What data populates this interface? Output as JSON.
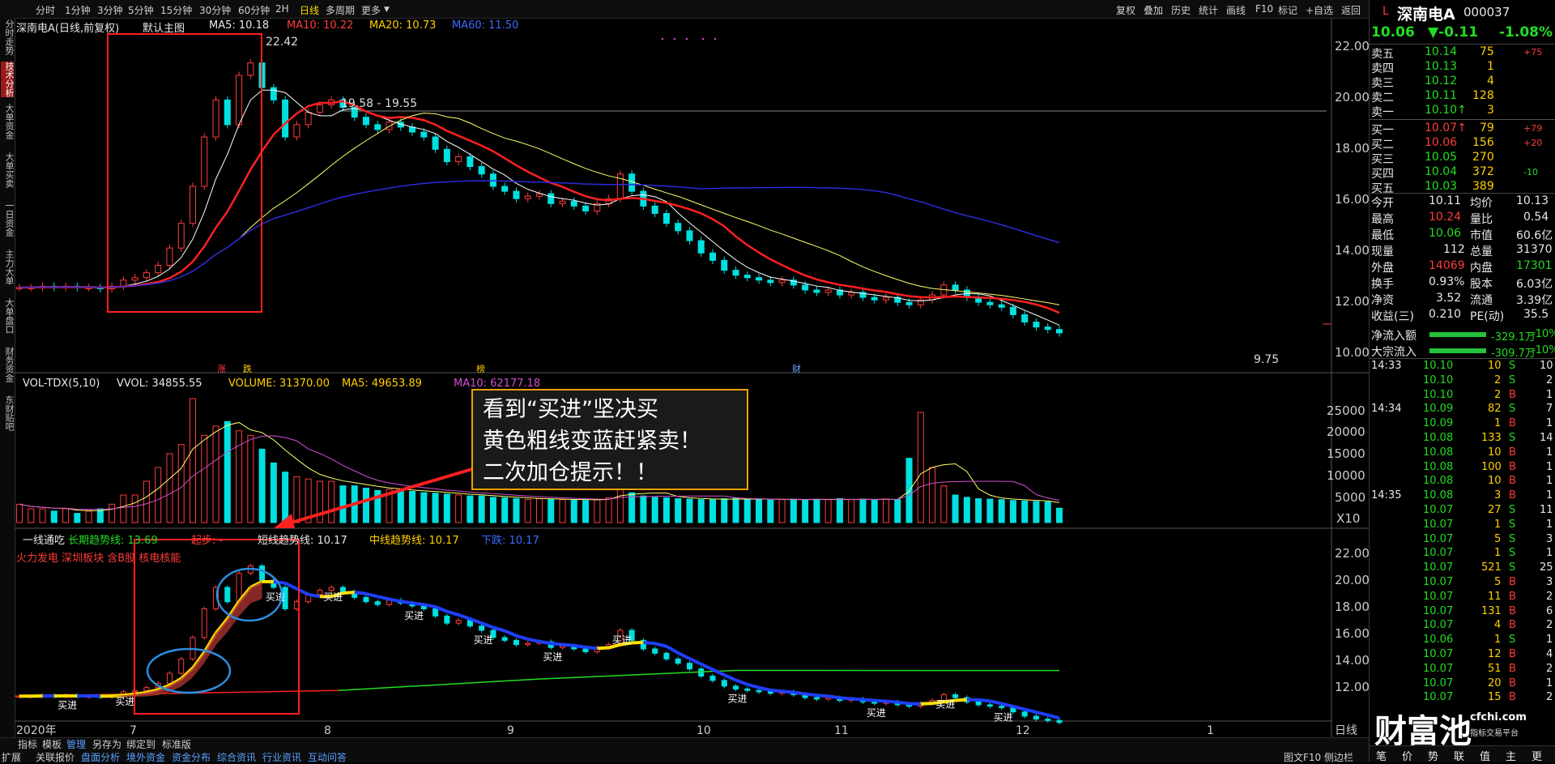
{
  "toolbar": {
    "periods": [
      "分时",
      "1分钟",
      "3分钟",
      "5分钟",
      "15分钟",
      "30分钟",
      "60分钟",
      "2H",
      "日线",
      "多周期",
      "更多"
    ],
    "active_period": "日线",
    "right_buttons": [
      "复权",
      "叠加",
      "历史",
      "统计",
      "画线",
      "F10",
      "标记",
      "+自选",
      "返回"
    ]
  },
  "left_tabs": [
    "分时走势",
    "技术分析",
    "大单资金",
    "大单买卖",
    "一日资金",
    "主力大单",
    "大单盘口",
    "财务资金",
    "东财贴吧"
  ],
  "main": {
    "stock_title": "深南电A(日线,前复权)",
    "indicator_name": "默认主图",
    "ma5": "MA5: 10.18",
    "ma10": "MA10: 10.22",
    "ma20": "MA20: 10.73",
    "ma60": "MA60: 11.50",
    "high_label": "22.42",
    "range_label": "19.58 - 19.55",
    "low_label": "9.75",
    "event_zhang": "涨",
    "event_die": "跌",
    "event_bang": "榜",
    "event_cai": "财",
    "y_ticks": [
      "22.00",
      "20.00",
      "18.00",
      "16.00",
      "14.00",
      "12.00",
      "10.00"
    ]
  },
  "volume": {
    "title": "VOL-TDX(5,10)",
    "vvol": "VVOL: 34855.55",
    "vol": "VOLUME: 31370.00",
    "ma5": "MA5: 49653.89",
    "ma10": "MA10: 62177.18",
    "y_ticks": [
      "25000",
      "20000",
      "15000",
      "10000",
      "5000",
      "X10"
    ]
  },
  "indicator": {
    "title": "一线通吃",
    "long": "长期趋势线: 13.69",
    "start": "起步: -",
    "short": "短线趋势线: 10.17",
    "mid": "中线趋势线: 10.17",
    "drop": "下跌: 10.17",
    "tags": "火力发电 深圳板块 含B股 核电核能",
    "buy_label": "买进",
    "y_ticks": [
      "22.00",
      "20.00",
      "18.00",
      "16.00",
      "14.00",
      "12.00"
    ]
  },
  "x_axis": {
    "labels": [
      "2020年",
      "7",
      "8",
      "9",
      "10",
      "11",
      "12",
      "1"
    ],
    "period": "日线"
  },
  "callout": {
    "line1": "看到“买进”坚决买",
    "line2": "黄色粗线变蓝赶紧卖！",
    "line3": "二次加仓提示！！"
  },
  "bottom": {
    "tabs": [
      "指标",
      "模板",
      "管理",
      "另存为",
      "绑定到",
      "标准版"
    ],
    "row2": [
      "扩展",
      "关联报价",
      "盘面分析",
      "境外资金",
      "资金分布",
      "综合资讯",
      "行业资讯",
      "互动问答"
    ],
    "right": "图文F10 侧边栏"
  },
  "quote": {
    "flag": "L",
    "name": "深南电A",
    "code": "000037",
    "price": "10.06",
    "change": "▼-0.11",
    "pct": "-1.08%",
    "asks": [
      {
        "label": "卖五",
        "price": "10.14",
        "vol": "75",
        "chg": "+75"
      },
      {
        "label": "卖四",
        "price": "10.13",
        "vol": "1",
        "chg": ""
      },
      {
        "label": "卖三",
        "price": "10.12",
        "vol": "4",
        "chg": ""
      },
      {
        "label": "卖二",
        "price": "10.11",
        "vol": "128",
        "chg": ""
      },
      {
        "label": "卖一",
        "price": "10.10↑",
        "vol": "3",
        "chg": ""
      }
    ],
    "bids": [
      {
        "label": "买一",
        "price": "10.07↑",
        "vol": "79",
        "chg": "+79"
      },
      {
        "label": "买二",
        "price": "10.06",
        "vol": "156",
        "chg": "+20"
      },
      {
        "label": "买三",
        "price": "10.05",
        "vol": "270",
        "chg": ""
      },
      {
        "label": "买四",
        "price": "10.04",
        "vol": "372",
        "chg": "-10"
      },
      {
        "label": "买五",
        "price": "10.03",
        "vol": "389",
        "chg": ""
      }
    ],
    "stats": [
      [
        "今开",
        "10.11",
        "均价",
        "10.13"
      ],
      [
        "最高",
        "10.24",
        "量比",
        "0.54"
      ],
      [
        "最低",
        "10.06",
        "市值",
        "60.6亿"
      ],
      [
        "现量",
        "112",
        "总量",
        "31370"
      ],
      [
        "外盘",
        "14069",
        "内盘",
        "17301"
      ],
      [
        "换手",
        "0.93%",
        "股本",
        "6.03亿"
      ],
      [
        "净资",
        "3.52",
        "流通",
        "3.39亿"
      ],
      [
        "收益(三)",
        "0.210",
        "PE(动)",
        "35.5"
      ]
    ],
    "flows": [
      {
        "label": "净流入额",
        "value": "-329.1万",
        "pct": "-10%"
      },
      {
        "label": "大宗流入",
        "value": "-309.7万",
        "pct": "-10%"
      }
    ],
    "ticks": [
      [
        "14:33",
        "10.10",
        "10",
        "S",
        "10"
      ],
      [
        "",
        "10.10",
        "2",
        "S",
        "2"
      ],
      [
        "",
        "10.10",
        "2",
        "B",
        "1"
      ],
      [
        "14:34",
        "10.09",
        "82",
        "S",
        "7"
      ],
      [
        "",
        "10.09",
        "1",
        "B",
        "1"
      ],
      [
        "",
        "10.08",
        "133",
        "S",
        "14"
      ],
      [
        "",
        "10.08",
        "10",
        "B",
        "1"
      ],
      [
        "",
        "10.08",
        "100",
        "B",
        "1"
      ],
      [
        "",
        "10.08",
        "10",
        "B",
        "1"
      ],
      [
        "14:35",
        "10.08",
        "3",
        "B",
        "1"
      ],
      [
        "",
        "10.07",
        "27",
        "S",
        "11"
      ],
      [
        "",
        "10.07",
        "1",
        "S",
        "1"
      ],
      [
        "",
        "10.07",
        "5",
        "S",
        "3"
      ],
      [
        "",
        "10.07",
        "1",
        "S",
        "1"
      ],
      [
        "",
        "10.07",
        "521",
        "S",
        "25"
      ],
      [
        "",
        "10.07",
        "5",
        "B",
        "3"
      ],
      [
        "",
        "10.07",
        "11",
        "B",
        "2"
      ],
      [
        "",
        "10.07",
        "131",
        "B",
        "6"
      ],
      [
        "",
        "10.07",
        "4",
        "B",
        "2"
      ],
      [
        "",
        "10.06",
        "1",
        "S",
        "1"
      ],
      [
        "",
        "10.07",
        "12",
        "B",
        "4"
      ],
      [
        "",
        "10.07",
        "51",
        "B",
        "2"
      ],
      [
        "",
        "10.07",
        "20",
        "B",
        "1"
      ],
      [
        "",
        "10.07",
        "15",
        "B",
        "2"
      ]
    ],
    "bottom_tabs": [
      "笔",
      "价",
      "势",
      "联",
      "值",
      "主",
      "更"
    ],
    "logo": "财富池",
    "logo_site": "cfchi.com",
    "logo_sub": "指标交易平台"
  },
  "chart_data": {
    "type": "candlestick",
    "title": "深南电A(日线,前复权)",
    "x_labels": [
      "2020年",
      "7",
      "8",
      "9",
      "10",
      "11",
      "12",
      "1"
    ],
    "ylim": [
      9.5,
      22.5
    ],
    "closes": [
      11.9,
      11.9,
      11.95,
      11.9,
      11.95,
      11.9,
      11.9,
      11.85,
      11.95,
      12.2,
      12.3,
      12.5,
      12.8,
      13.5,
      14.5,
      16.0,
      18.0,
      19.5,
      18.5,
      20.5,
      21.0,
      20.0,
      19.5,
      18.0,
      18.5,
      19.0,
      19.3,
      19.5,
      19.2,
      18.8,
      18.5,
      18.3,
      18.6,
      18.4,
      18.2,
      18.0,
      17.5,
      17.0,
      17.2,
      16.8,
      16.5,
      16.0,
      15.8,
      15.5,
      15.6,
      15.7,
      15.3,
      15.4,
      15.2,
      15.0,
      15.3,
      15.5,
      16.5,
      15.8,
      15.2,
      14.9,
      14.5,
      14.2,
      13.8,
      13.3,
      13.0,
      12.6,
      12.4,
      12.3,
      12.2,
      12.1,
      12.2,
      12.0,
      11.8,
      11.7,
      11.8,
      11.6,
      11.7,
      11.5,
      11.4,
      11.5,
      11.3,
      11.2,
      11.4,
      11.6,
      12.0,
      11.8,
      11.5,
      11.3,
      11.2,
      11.1,
      10.8,
      10.5,
      10.3,
      10.2,
      10.06
    ],
    "volumes": [
      4000,
      3000,
      3000,
      2500,
      3000,
      2000,
      2500,
      3000,
      4000,
      6000,
      6000,
      9000,
      12000,
      15000,
      17000,
      27000,
      19000,
      21000,
      22000,
      20000,
      19000,
      16000,
      13000,
      11000,
      10000,
      9500,
      9000,
      9000,
      8000,
      8000,
      7500,
      7000,
      7200,
      7000,
      6800,
      6500,
      6400,
      6200,
      6000,
      5800,
      5800,
      5500,
      5400,
      5200,
      5000,
      5200,
      5100,
      5000,
      4900,
      4800,
      5000,
      5400,
      9000,
      6500,
      5800,
      5500,
      5400,
      5200,
      5100,
      5000,
      5000,
      5200,
      5300,
      5100,
      5000,
      4900,
      5000,
      5100,
      5000,
      5100,
      5000,
      5200,
      5000,
      5100,
      5000,
      5100,
      5000,
      14000,
      24000,
      12000,
      8000,
      6000,
      5500,
      5200,
      5100,
      5000,
      4800,
      4700,
      4600,
      4500,
      3137
    ],
    "ma": [
      {
        "name": "MA5",
        "color": "#ffffff"
      },
      {
        "name": "MA10",
        "color": "#ff2020"
      },
      {
        "name": "MA20",
        "color": "#ffff66"
      },
      {
        "name": "MA60",
        "color": "#2b2bd9"
      }
    ]
  }
}
